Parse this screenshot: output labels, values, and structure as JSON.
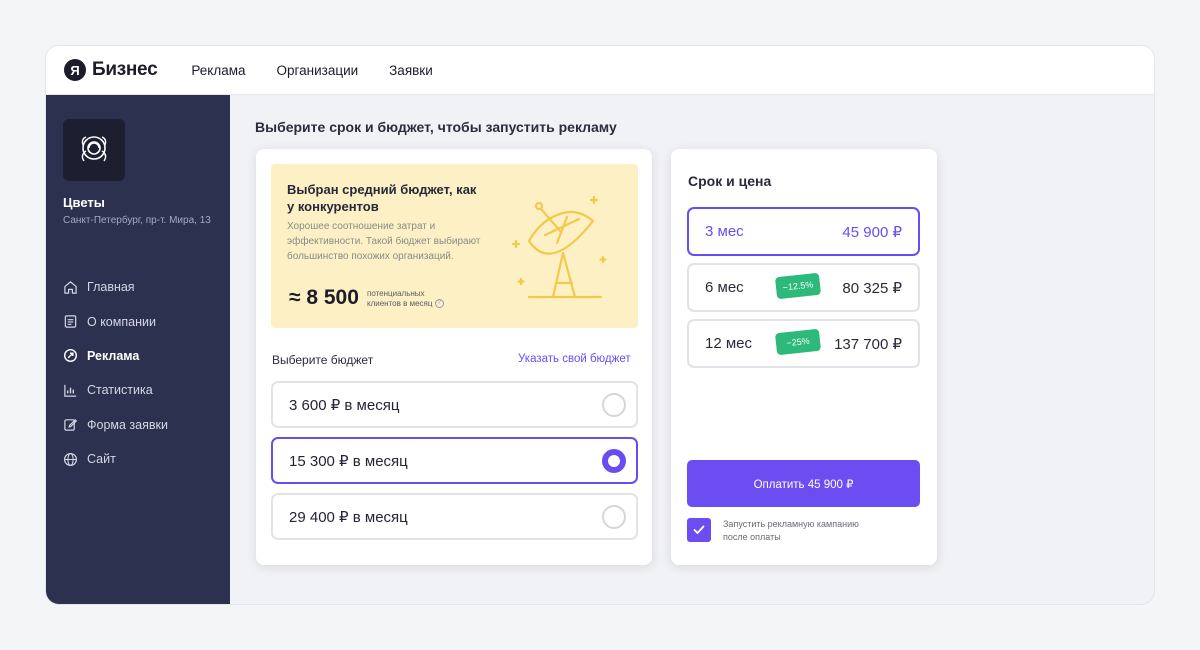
{
  "brand": {
    "logo_letter": "Я",
    "name": "Бизнес"
  },
  "topnav": [
    "Реклама",
    "Организации",
    "Заявки"
  ],
  "org": {
    "name": "Цветы",
    "address": "Санкт-Петербург, пр-т. Мира, 13"
  },
  "sidebar": {
    "items": [
      {
        "label": "Главная",
        "icon": "home-icon",
        "active": false
      },
      {
        "label": "О компании",
        "icon": "document-icon",
        "active": false
      },
      {
        "label": "Реклама",
        "icon": "ad-icon",
        "active": true
      },
      {
        "label": "Статистика",
        "icon": "chart-icon",
        "active": false
      },
      {
        "label": "Форма заявки",
        "icon": "edit-icon",
        "active": false
      },
      {
        "label": "Сайт",
        "icon": "globe-icon",
        "active": false
      }
    ]
  },
  "page_title": "Выберите срок и бюджет, чтобы запустить рекламу",
  "promo": {
    "title": "Выбран средний бюджет, как у конкурентов",
    "description": "Хорошее соотношение затрат и эффективности. Такой бюджет выбирают большинство похожих организаций.",
    "clients_value": "≈ 8 500",
    "clients_label": "потенциальных клиентов в месяц"
  },
  "budget": {
    "label": "Выберите бюджет",
    "custom_link": "Указать свой бюджет",
    "options": [
      {
        "label": "3 600 ₽ в месяц",
        "selected": false
      },
      {
        "label": "15 300 ₽ в месяц",
        "selected": true
      },
      {
        "label": "29 400 ₽ в месяц",
        "selected": false
      }
    ]
  },
  "pricing": {
    "title": "Срок и цена",
    "terms": [
      {
        "name": "3 мес",
        "price": "45 900 ₽",
        "discount": "",
        "selected": true
      },
      {
        "name": "6 мес",
        "price": "80 325 ₽",
        "discount": "−12.5%",
        "selected": false
      },
      {
        "name": "12 мес",
        "price": "137 700 ₽",
        "discount": "−25%",
        "selected": false
      }
    ],
    "pay_button": "Оплатить 45 900 ₽",
    "autostart_checked": true,
    "autostart_label": "Запустить рекламную кампанию после оплаты"
  },
  "colors": {
    "accent": "#6c4df2",
    "sidebar": "#2d3150",
    "discount": "#2cb97a",
    "promo_bg": "#fdf0c5"
  }
}
